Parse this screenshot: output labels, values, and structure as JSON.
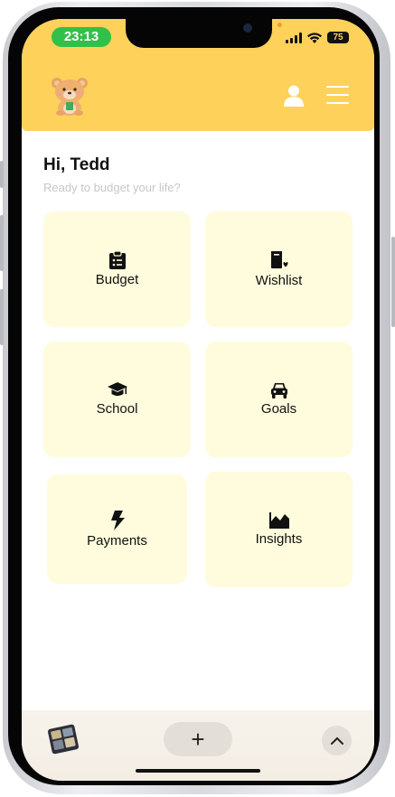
{
  "status_bar": {
    "time": "23:13",
    "battery": "75"
  },
  "header": {
    "logo": "bear-mascot-logo",
    "icons": [
      "user-icon",
      "hamburger-menu-icon"
    ],
    "color": "#fdd15a"
  },
  "greeting": {
    "title": "Hi, Tedd",
    "subtitle": "Ready to budget your life?"
  },
  "tiles": [
    {
      "label": "Budget",
      "icon": "clipboard-list-icon"
    },
    {
      "label": "Wishlist",
      "icon": "bookmark-heart-icon"
    },
    {
      "label": "School",
      "icon": "graduation-cap-icon"
    },
    {
      "label": "Goals",
      "icon": "car-icon"
    },
    {
      "label": "Payments",
      "icon": "lightning-bolt-icon"
    },
    {
      "label": "Insights",
      "icon": "area-chart-icon"
    }
  ],
  "toolbar": {
    "add_button": "+",
    "icons": [
      "tab-thumbnail-icon",
      "plus-icon",
      "chevron-up-icon"
    ]
  },
  "colors": {
    "tile_bg": "#fefcdc",
    "status_pill": "#31c04a"
  }
}
